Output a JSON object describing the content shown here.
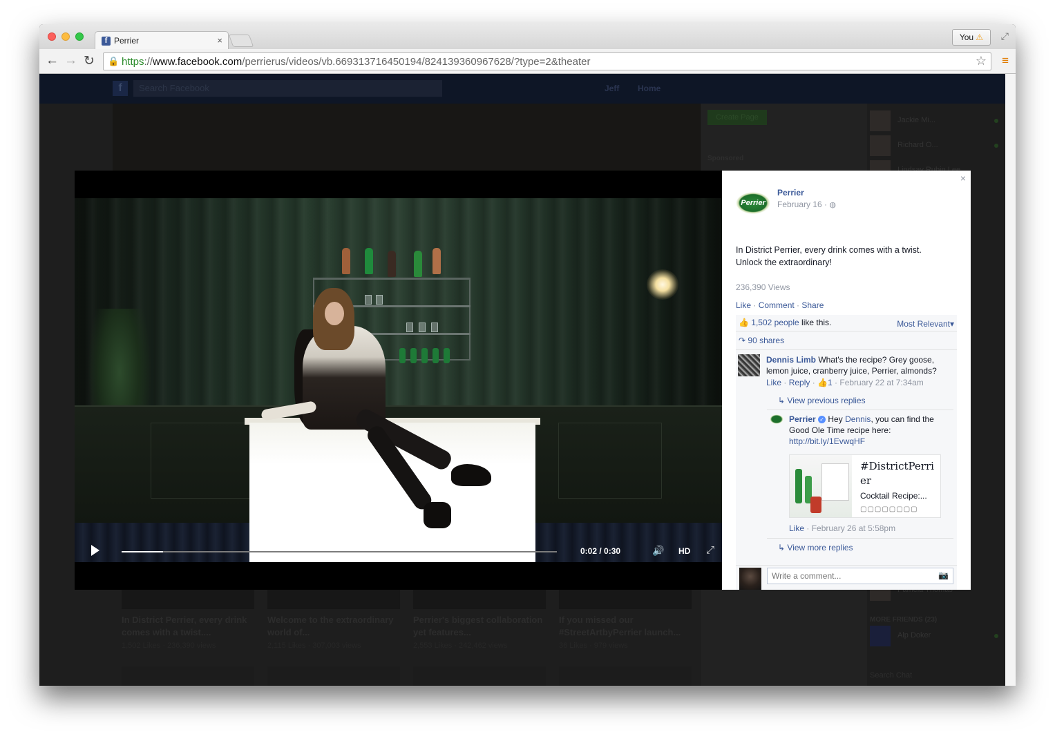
{
  "browser": {
    "tab_title": "Perrier",
    "tab_close": "×",
    "favicon_letter": "f",
    "profile_label": "You",
    "profile_warning": "⚠",
    "url_scheme": "https",
    "url_sep": "://",
    "url_host": "www.facebook.com",
    "url_path": "/perrierus/videos/vb.669313716450194/824139360967628/?type=2&theater"
  },
  "facebook_bg": {
    "search_placeholder": "Search Facebook",
    "nav_user": "Jeff",
    "nav_home": "Home",
    "create_page": "Create Page",
    "sponsored": "Sponsored",
    "chat_contacts": [
      {
        "name": "Jackie Mi..."
      },
      {
        "name": "Richard O..."
      },
      {
        "name": "Lindsay Rubin Lee"
      }
    ],
    "chat_more_friends": "MORE FRIENDS (23)",
    "chat_friend_extra": "Alp Doker",
    "chat_friend_pamela": "Pamela Thomas",
    "chat_search": "Search Chat",
    "videos": [
      {
        "title": "In District Perrier, every drink comes with a twist....",
        "meta": "1,502 Likes · 236,390 views"
      },
      {
        "title": "Welcome to the extraordinary world of...",
        "meta": "2,115 Likes · 307,003 views"
      },
      {
        "title": "Perrier's biggest collaboration yet features...",
        "meta": "2,553 Likes · 242,462 views"
      },
      {
        "title": "If you missed our #StreetArtbyPerrier launch...",
        "meta": "36 Likes · 979 views"
      }
    ]
  },
  "player": {
    "time": "0:02 / 0:30",
    "hd_label": "HD",
    "progress_fraction": 0.095
  },
  "post": {
    "page_name": "Perrier",
    "logo_text": "Perrier",
    "date": "February 16 ·",
    "text_line1": "In District Perrier, every drink comes with a twist.",
    "text_line2": "Unlock the extraordinary!",
    "views": "236,390 Views",
    "action_like": "Like",
    "action_comment": "Comment",
    "action_share": "Share",
    "likes_count": "1,502 people",
    "likes_suffix": "like this.",
    "sort_label": "Most Relevant",
    "shares": "90 shares",
    "comment": {
      "author": "Dennis Limb",
      "text": "What's the recipe? Grey goose, lemon juice, cranberry juice, Perrier, almonds?",
      "like": "Like",
      "reply": "Reply",
      "like_count": "1",
      "timestamp": "February 22 at 7:34am"
    },
    "view_previous_replies": "View previous replies",
    "reply": {
      "author": "Perrier",
      "text_before": "Hey",
      "mention": "Dennis",
      "text_after": ", you can find the Good Ole Time recipe here:",
      "link": "http://bit.ly/1EvwqHF",
      "preview_title": "#DistrictPerrier",
      "preview_desc": "Cocktail Recipe:...",
      "preview_glyphs": "▢▢▢▢▢▢▢▢",
      "like": "Like",
      "timestamp": "February 26 at 5:58pm"
    },
    "view_more_replies": "View more replies",
    "comment_placeholder": "Write a comment..."
  }
}
